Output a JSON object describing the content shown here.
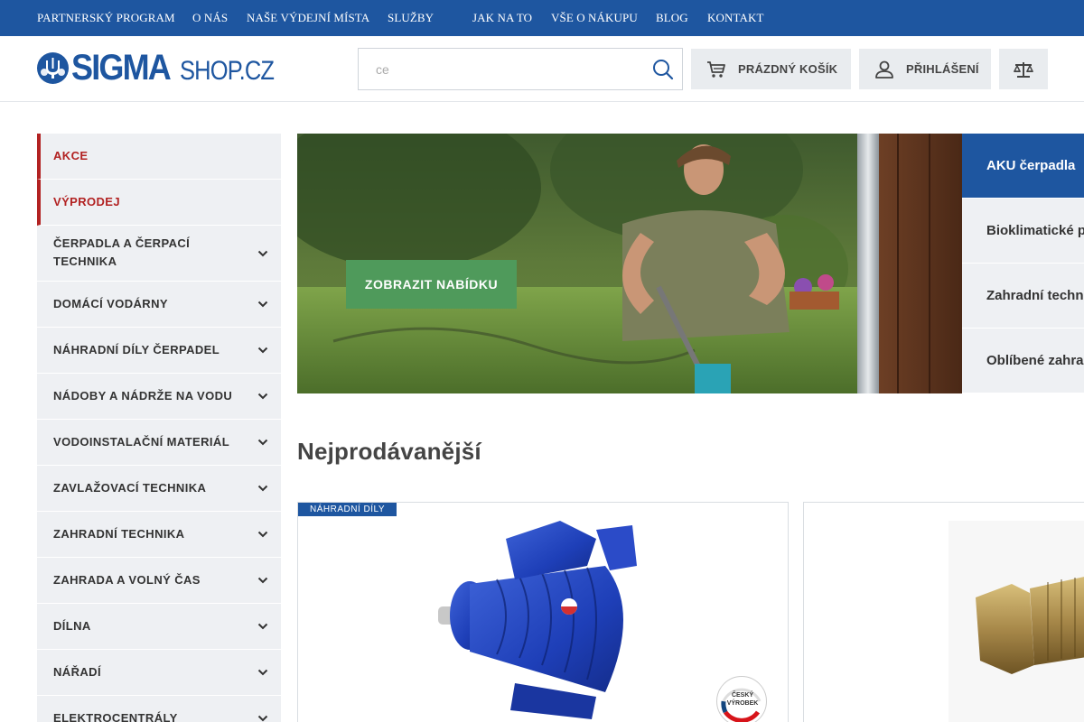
{
  "topnav": {
    "items": [
      {
        "label": "PARTNERSKÝ PROGRAM"
      },
      {
        "label": "O NÁS"
      },
      {
        "label": "NAŠE VÝDEJNÍ MÍSTA"
      },
      {
        "label": "SLUŽBY"
      },
      {
        "label": "JAK NA TO"
      },
      {
        "label": "VŠE O NÁKUPU"
      },
      {
        "label": "BLOG"
      },
      {
        "label": "KONTAKT"
      }
    ]
  },
  "header": {
    "logo_main": "SIGMA",
    "logo_sub": "SHOP.CZ",
    "search_value": "",
    "search_placeholder": "ce",
    "cart_label": "PRÁZDNÝ KOŠÍK",
    "login_label": "PŘIHLÁŠENÍ",
    "icons": {
      "search": "search-icon",
      "cart": "cart-icon",
      "user": "user-icon",
      "compare": "scales-icon"
    }
  },
  "sidebar": {
    "items": [
      {
        "label": "AKCE",
        "highlight": true,
        "has_children": false
      },
      {
        "label": "VÝPRODEJ",
        "highlight": true,
        "has_children": false
      },
      {
        "label": "ČERPADLA A ČERPACÍ TECHNIKA",
        "has_children": true
      },
      {
        "label": "DOMÁCÍ VODÁRNY",
        "has_children": true
      },
      {
        "label": "NÁHRADNÍ DÍLY ČERPADEL",
        "has_children": true
      },
      {
        "label": "NÁDOBY A NÁDRŽE NA VODU",
        "has_children": true
      },
      {
        "label": "VODOINSTALAČNÍ MATERIÁL",
        "has_children": true
      },
      {
        "label": "ZAVLAŽOVACÍ TECHNIKA",
        "has_children": true
      },
      {
        "label": "ZAHRADNÍ TECHNIKA",
        "has_children": true
      },
      {
        "label": "ZAHRADA A VOLNÝ ČAS",
        "has_children": true
      },
      {
        "label": "DÍLNA",
        "has_children": true
      },
      {
        "label": "NÁŘADÍ",
        "has_children": true
      },
      {
        "label": "ELEKTROCENTRÁLY",
        "has_children": true
      }
    ],
    "highlight_color": "#b22222"
  },
  "banner": {
    "cta_label": "ZOBRAZIT NABÍDKU",
    "tabs": [
      {
        "label": "AKU čerpadla",
        "active": true
      },
      {
        "label": "Bioklimatické p"
      },
      {
        "label": "Zahradní techn"
      },
      {
        "label": "Oblíbené zahra"
      }
    ]
  },
  "bestsellers": {
    "title": "Nejprodávanější",
    "products": [
      {
        "badge": "NÁHRADNÍ DÍLY",
        "origin_badge_line1": "ČESKÝ",
        "origin_badge_line2": "VÝROBEK"
      },
      {
        "badge": ""
      }
    ]
  },
  "colors": {
    "brand": "#1e56a0",
    "accent_red": "#b22222",
    "cta_green": "#4f9a5b",
    "panel_grey": "#eef0f3"
  }
}
